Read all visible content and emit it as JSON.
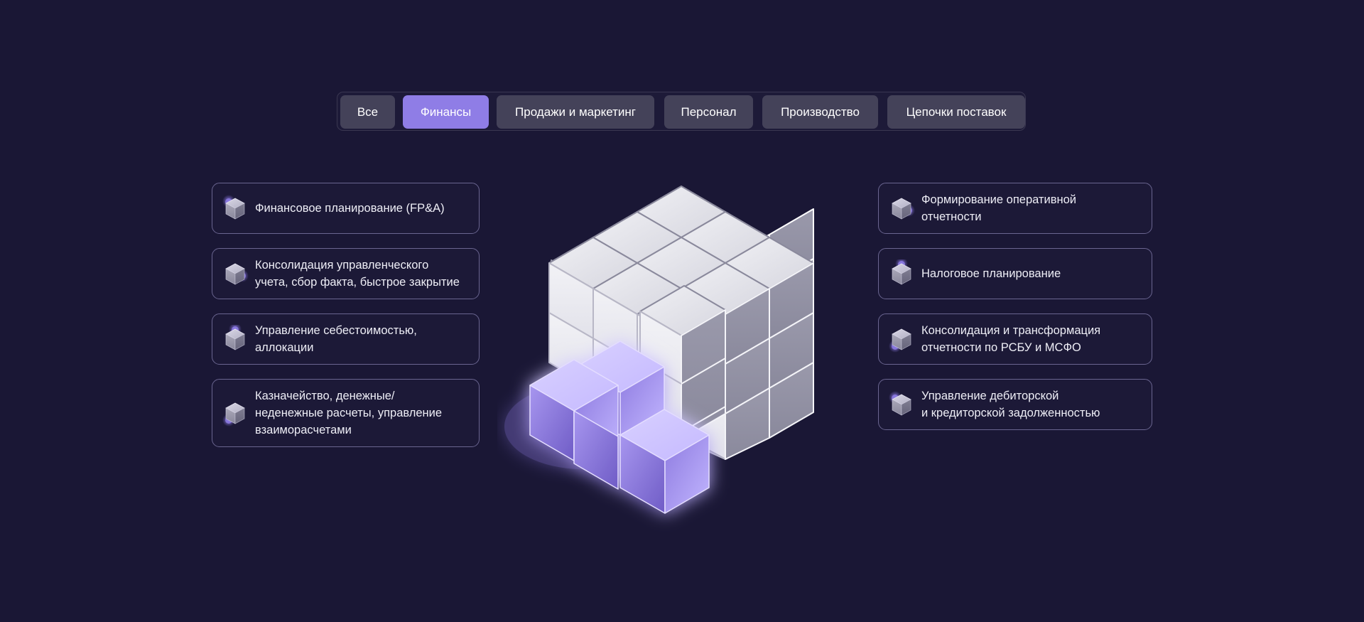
{
  "tabs": [
    {
      "label": "Все"
    },
    {
      "label": "Финансы"
    },
    {
      "label": "Продажи и маркетинг"
    },
    {
      "label": "Персонал"
    },
    {
      "label": "Производство"
    },
    {
      "label": "Цепочки поставок"
    }
  ],
  "active_tab": "Финансы",
  "left_cards": [
    {
      "label": "Финансовое планирование (FP&A)",
      "icon": "cube-icon"
    },
    {
      "label": "Консолидация управленческого\nучета, сбор факта, быстрое закрытие",
      "icon": "cube-icon"
    },
    {
      "label": "Управление себестоимостью,\nаллокации",
      "icon": "cube-icon"
    },
    {
      "label": "Казначейство, денежные/\nнеденежные расчеты, управление\nвзаиморасчетами",
      "icon": "cube-icon"
    }
  ],
  "right_cards": [
    {
      "label": "Формирование оперативной\nотчетности",
      "icon": "cube-icon"
    },
    {
      "label": "Налоговое планирование",
      "icon": "cube-icon"
    },
    {
      "label": "Консолидация и трансформация\nотчетности по РСБУ и МСФО",
      "icon": "cube-icon"
    },
    {
      "label": "Управление дебиторской\nи кредиторской задолженностью",
      "icon": "cube-icon"
    }
  ],
  "colors": {
    "background": "#1a1735",
    "tab": "#444259",
    "tab_active": "#8f7de6",
    "card_border": "#6a6590",
    "accent_purple": "#8f7de6",
    "cube_light": "#ebebf0",
    "cube_dark": "#8c8b9e"
  }
}
